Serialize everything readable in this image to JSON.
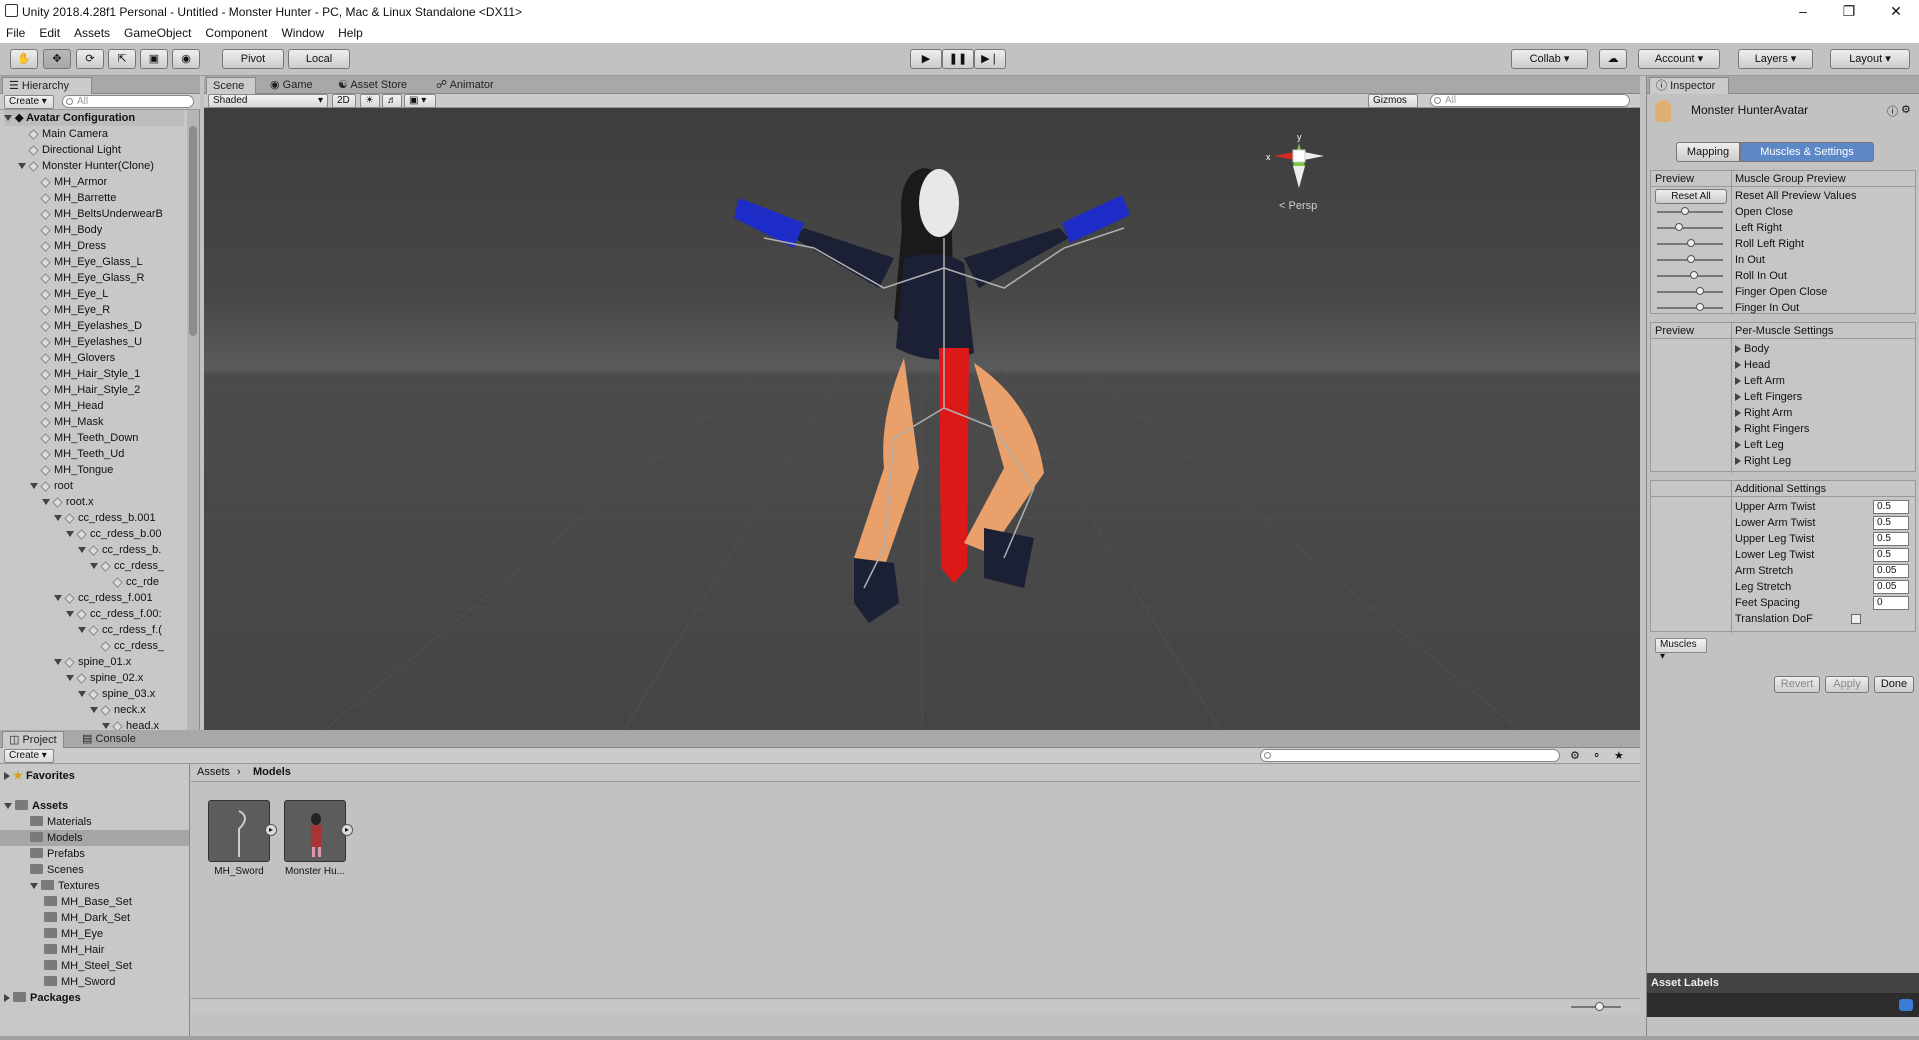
{
  "window": {
    "title": "Unity 2018.4.28f1 Personal - Untitled - Monster Hunter - PC, Mac & Linux Standalone <DX11>"
  },
  "menu": [
    "File",
    "Edit",
    "Assets",
    "GameObject",
    "Component",
    "Window",
    "Help"
  ],
  "toolbar": {
    "pivot": "Pivot",
    "local": "Local",
    "collab": "Collab",
    "account": "Account",
    "layers": "Layers",
    "layout": "Layout"
  },
  "hierarchy": {
    "tab": "Hierarchy",
    "create": "Create",
    "search_placeholder": "All",
    "scene_root": "Avatar Configuration",
    "items": [
      {
        "label": "Main Camera",
        "indent": 1,
        "arrow": ""
      },
      {
        "label": "Directional Light",
        "indent": 1,
        "arrow": ""
      },
      {
        "label": "Monster Hunter(Clone)",
        "indent": 1,
        "arrow": "down"
      },
      {
        "label": "MH_Armor",
        "indent": 2,
        "arrow": ""
      },
      {
        "label": "MH_Barrette",
        "indent": 2,
        "arrow": ""
      },
      {
        "label": "MH_BeltsUnderwearB",
        "indent": 2,
        "arrow": ""
      },
      {
        "label": "MH_Body",
        "indent": 2,
        "arrow": ""
      },
      {
        "label": "MH_Dress",
        "indent": 2,
        "arrow": ""
      },
      {
        "label": "MH_Eye_Glass_L",
        "indent": 2,
        "arrow": ""
      },
      {
        "label": "MH_Eye_Glass_R",
        "indent": 2,
        "arrow": ""
      },
      {
        "label": "MH_Eye_L",
        "indent": 2,
        "arrow": ""
      },
      {
        "label": "MH_Eye_R",
        "indent": 2,
        "arrow": ""
      },
      {
        "label": "MH_Eyelashes_D",
        "indent": 2,
        "arrow": ""
      },
      {
        "label": "MH_Eyelashes_U",
        "indent": 2,
        "arrow": ""
      },
      {
        "label": "MH_Glovers",
        "indent": 2,
        "arrow": ""
      },
      {
        "label": "MH_Hair_Style_1",
        "indent": 2,
        "arrow": ""
      },
      {
        "label": "MH_Hair_Style_2",
        "indent": 2,
        "arrow": ""
      },
      {
        "label": "MH_Head",
        "indent": 2,
        "arrow": ""
      },
      {
        "label": "MH_Mask",
        "indent": 2,
        "arrow": ""
      },
      {
        "label": "MH_Teeth_Down",
        "indent": 2,
        "arrow": ""
      },
      {
        "label": "MH_Teeth_Ud",
        "indent": 2,
        "arrow": ""
      },
      {
        "label": "MH_Tongue",
        "indent": 2,
        "arrow": ""
      },
      {
        "label": "root",
        "indent": 2,
        "arrow": "down"
      },
      {
        "label": "root.x",
        "indent": 3,
        "arrow": "down"
      },
      {
        "label": "cc_rdess_b.001",
        "indent": 4,
        "arrow": "down"
      },
      {
        "label": "cc_rdess_b.00",
        "indent": 5,
        "arrow": "down"
      },
      {
        "label": "cc_rdess_b.",
        "indent": 6,
        "arrow": "down"
      },
      {
        "label": "cc_rdess_",
        "indent": 7,
        "arrow": "down"
      },
      {
        "label": "cc_rde",
        "indent": 8,
        "arrow": ""
      },
      {
        "label": "cc_rdess_f.001",
        "indent": 4,
        "arrow": "down"
      },
      {
        "label": "cc_rdess_f.00:",
        "indent": 5,
        "arrow": "down"
      },
      {
        "label": "cc_rdess_f.(",
        "indent": 6,
        "arrow": "down"
      },
      {
        "label": "cc_rdess_",
        "indent": 7,
        "arrow": ""
      },
      {
        "label": "spine_01.x",
        "indent": 4,
        "arrow": "down"
      },
      {
        "label": "spine_02.x",
        "indent": 5,
        "arrow": "down"
      },
      {
        "label": "spine_03.x",
        "indent": 6,
        "arrow": "down"
      },
      {
        "label": "neck.x",
        "indent": 7,
        "arrow": "down"
      },
      {
        "label": "head.x",
        "indent": 8,
        "arrow": "down"
      }
    ]
  },
  "scene": {
    "tabs": [
      "Scene",
      "Game",
      "Asset Store",
      "Animator"
    ],
    "shading": "Shaded",
    "mode2d": "2D",
    "gizmos": "Gizmos",
    "search_placeholder": "All",
    "persp": "Persp",
    "gizmo_labels": {
      "x": "x",
      "y": "y"
    }
  },
  "inspector": {
    "tab": "Inspector",
    "object": "Monster HunterAvatar",
    "mode_tabs": [
      "Mapping",
      "Muscles & Settings"
    ],
    "muscle_group": {
      "col1": "Preview",
      "col2": "Muscle Group Preview",
      "reset_btn": "Reset All",
      "reset_label": "Reset All Preview Values",
      "rows": [
        {
          "label": "Open Close",
          "value": 0.4
        },
        {
          "label": "Left Right",
          "value": 0.3
        },
        {
          "label": "Roll Left Right",
          "value": 0.5
        },
        {
          "label": "In Out",
          "value": 0.5
        },
        {
          "label": "Roll In Out",
          "value": 0.55
        },
        {
          "label": "Finger Open Close",
          "value": 0.65
        },
        {
          "label": "Finger In Out",
          "value": 0.65
        }
      ]
    },
    "per_muscle": {
      "col1": "Preview",
      "col2": "Per-Muscle Settings",
      "rows": [
        "Body",
        "Head",
        "Left Arm",
        "Left Fingers",
        "Right Arm",
        "Right Fingers",
        "Left Leg",
        "Right Leg"
      ]
    },
    "additional": {
      "title": "Additional Settings",
      "rows": [
        {
          "label": "Upper Arm Twist",
          "value": "0.5"
        },
        {
          "label": "Lower Arm Twist",
          "value": "0.5"
        },
        {
          "label": "Upper Leg Twist",
          "value": "0.5"
        },
        {
          "label": "Lower Leg Twist",
          "value": "0.5"
        },
        {
          "label": "Arm Stretch",
          "value": "0.05"
        },
        {
          "label": "Leg Stretch",
          "value": "0.05"
        },
        {
          "label": "Feet Spacing",
          "value": "0"
        }
      ],
      "translation_dof": "Translation DoF"
    },
    "muscles_dropdown": "Muscles",
    "revert": "Revert",
    "apply": "Apply",
    "done": "Done",
    "asset_labels": "Asset Labels"
  },
  "project": {
    "tabs": [
      "Project",
      "Console"
    ],
    "create": "Create",
    "favorites": "Favorites",
    "assets": "Assets",
    "folders": [
      {
        "label": "Materials",
        "indent": 1
      },
      {
        "label": "Models",
        "indent": 1,
        "selected": true
      },
      {
        "label": "Prefabs",
        "indent": 1
      },
      {
        "label": "Scenes",
        "indent": 1
      },
      {
        "label": "Textures",
        "indent": 1,
        "open": true
      },
      {
        "label": "MH_Base_Set",
        "indent": 2
      },
      {
        "label": "MH_Dark_Set",
        "indent": 2
      },
      {
        "label": "MH_Eye",
        "indent": 2
      },
      {
        "label": "MH_Hair",
        "indent": 2
      },
      {
        "label": "MH_Steel_Set",
        "indent": 2
      },
      {
        "label": "MH_Sword",
        "indent": 2
      }
    ],
    "packages": "Packages",
    "breadcrumb": [
      "Assets",
      "Models"
    ],
    "items": [
      {
        "label": "MH_Sword",
        "icon": "sword-model"
      },
      {
        "label": "Monster Hu...",
        "icon": "character-model"
      }
    ]
  }
}
